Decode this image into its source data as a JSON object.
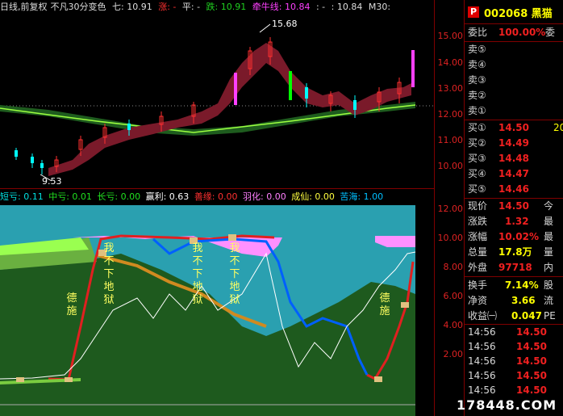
{
  "header": {
    "period": "日线,前复权",
    "indicator": "不凡30分变色",
    "qi": "七: 10.91",
    "zhang": "涨: -",
    "ping": "平: -",
    "die": "跌: 10.91",
    "niuxian_label": "牵牛线: 10.84",
    "niuxian_sep": ": -",
    "niuxian_val2": ": 10.84",
    "ma": "M30:"
  },
  "price_axis": [
    "15.00",
    "14.00",
    "13.00",
    "12.00",
    "11.00",
    "10.00"
  ],
  "price_labels": {
    "high": "15.68",
    "low": "9.53"
  },
  "indicator_header": {
    "duan": "短亏: 0.11",
    "zhong": "中亏: 0.01",
    "chang": "长亏: 0.00",
    "yingli": "赢利: 0.63",
    "shanyuan": "善缘: 0.00",
    "yuhua": "羽化: 0.00",
    "chengxian": "成仙: 0.00",
    "kuhai": "苦海: 1.00"
  },
  "ind_axis": [
    "12.00",
    "10.00",
    "8.00",
    "6.00",
    "4.00",
    "2.00"
  ],
  "overlay_texts": {
    "dexshi_left": "德施",
    "wo1": "我不下地狱",
    "wo2": "我不下地狱",
    "wo3": "我不下地狱",
    "dexshi_right": "德施"
  },
  "right_panel": {
    "badge": "P",
    "code_name": "002068 黑猫",
    "weibi_label": "委比",
    "weibi_value": "100.00%",
    "weibi_extra": "委",
    "sells": [
      {
        "label": "卖⑤"
      },
      {
        "label": "卖④"
      },
      {
        "label": "卖③"
      },
      {
        "label": "卖②"
      },
      {
        "label": "卖①"
      }
    ],
    "buys": [
      {
        "label": "买①",
        "price": "14.50",
        "vol": "20"
      },
      {
        "label": "买②",
        "price": "14.49"
      },
      {
        "label": "买③",
        "price": "14.48"
      },
      {
        "label": "买④",
        "price": "14.47"
      },
      {
        "label": "买⑤",
        "price": "14.46"
      }
    ],
    "stats": [
      {
        "label": "现价",
        "value": "14.50",
        "extra": "今"
      },
      {
        "label": "涨跌",
        "value": "1.32",
        "extra": "最"
      },
      {
        "label": "涨幅",
        "value": "10.02%",
        "extra": "最"
      },
      {
        "label": "总量",
        "value": "17.8万",
        "extra": "量"
      },
      {
        "label": "外盘",
        "value": "97718",
        "extra": "内"
      }
    ],
    "stats2": [
      {
        "label": "换手",
        "value": "7.14%",
        "extra": "股"
      },
      {
        "label": "净资",
        "value": "3.66",
        "extra": "流"
      },
      {
        "label": "收益㈠",
        "value": "0.047",
        "extra": "PE"
      }
    ],
    "ticks": [
      {
        "time": "14:56",
        "price": "14.50"
      },
      {
        "time": "14:56",
        "price": "14.50"
      },
      {
        "time": "14:56",
        "price": "14.50"
      },
      {
        "time": "14:56",
        "price": "14.50"
      },
      {
        "time": "14:56",
        "price": "14.50"
      }
    ]
  },
  "watermark": "178448.COM"
}
